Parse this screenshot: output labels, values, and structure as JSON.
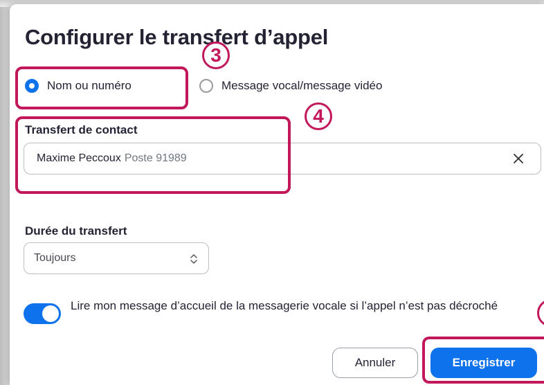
{
  "dialog": {
    "title": "Configurer le transfert d’appel"
  },
  "forward_type": {
    "options": [
      {
        "label": "Nom ou numéro",
        "selected": true
      },
      {
        "label": "Message vocal/message vidéo",
        "selected": false
      }
    ]
  },
  "contact": {
    "label": "Transfert de contact",
    "name": "Maxime Peccoux",
    "extension": "Poste 91989"
  },
  "duration": {
    "label": "Durée du transfert",
    "value": "Toujours"
  },
  "greeting_toggle": {
    "enabled": true,
    "label": "Lire mon message d’accueil de la messagerie vocale si l’appel n’est pas décroché"
  },
  "buttons": {
    "cancel": "Annuler",
    "save": "Enregistrer"
  },
  "annotations": {
    "step_3": "3",
    "step_4": "4",
    "highlight_color": "#c2185b"
  },
  "colors": {
    "accent": "#0e72ed"
  },
  "icons": {
    "clear": "close-icon",
    "select": "up-down-chevron-icon"
  }
}
